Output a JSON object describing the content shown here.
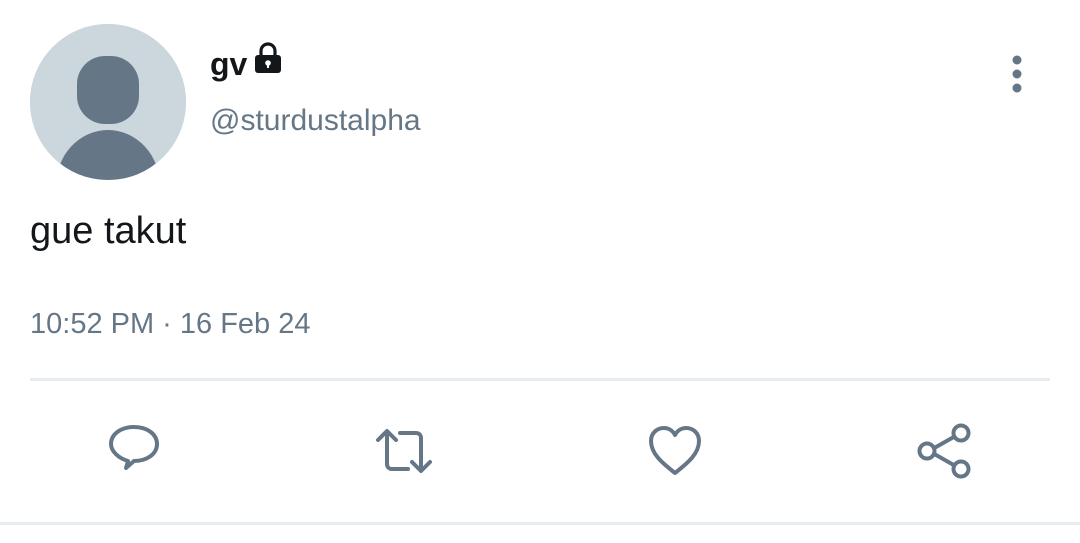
{
  "tweet": {
    "display_name": "gv",
    "handle": "@sturdustalpha",
    "text": "gue takut",
    "timestamp": "10:52 PM · 16 Feb 24",
    "protected_icon": "lock-icon",
    "avatar_icon": "default-avatar-icon"
  },
  "actions": [
    {
      "name": "reply",
      "icon": "reply-icon"
    },
    {
      "name": "retweet",
      "icon": "retweet-icon"
    },
    {
      "name": "like",
      "icon": "heart-icon"
    },
    {
      "name": "share",
      "icon": "share-icon"
    }
  ],
  "colors": {
    "text_primary": "#14171a",
    "text_secondary": "#657786",
    "avatar_bg": "#ccd6dd",
    "avatar_fg": "#657786",
    "divider": "#e6ecf0"
  }
}
